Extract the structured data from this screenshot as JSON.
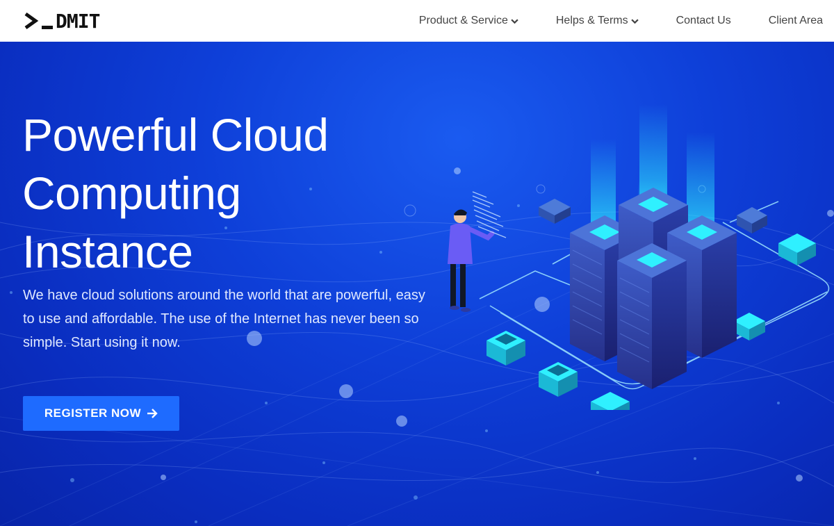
{
  "header": {
    "logo_text": "DMIT",
    "logo_prompt": "❯_",
    "nav": [
      {
        "label": "Product & Service",
        "has_dropdown": true
      },
      {
        "label": "Helps & Terms",
        "has_dropdown": true
      },
      {
        "label": "Contact Us",
        "has_dropdown": false
      },
      {
        "label": "Client Area",
        "has_dropdown": false
      }
    ]
  },
  "hero": {
    "title_line1": "Powerful Cloud",
    "title_line2": "Computing",
    "title_line3": "Instance",
    "description": "We have cloud solutions around the world that are powerful, easy to use and affordable. The use of the Internet has never been so simple. Start using it now.",
    "cta_label": "REGISTER NOW",
    "cta_icon": "arrow-right-icon"
  },
  "colors": {
    "header_bg": "#ffffff",
    "hero_bg": "#0e3fd8",
    "cta_bg": "#1e6bff",
    "accent_cyan": "#2ff0ff"
  }
}
